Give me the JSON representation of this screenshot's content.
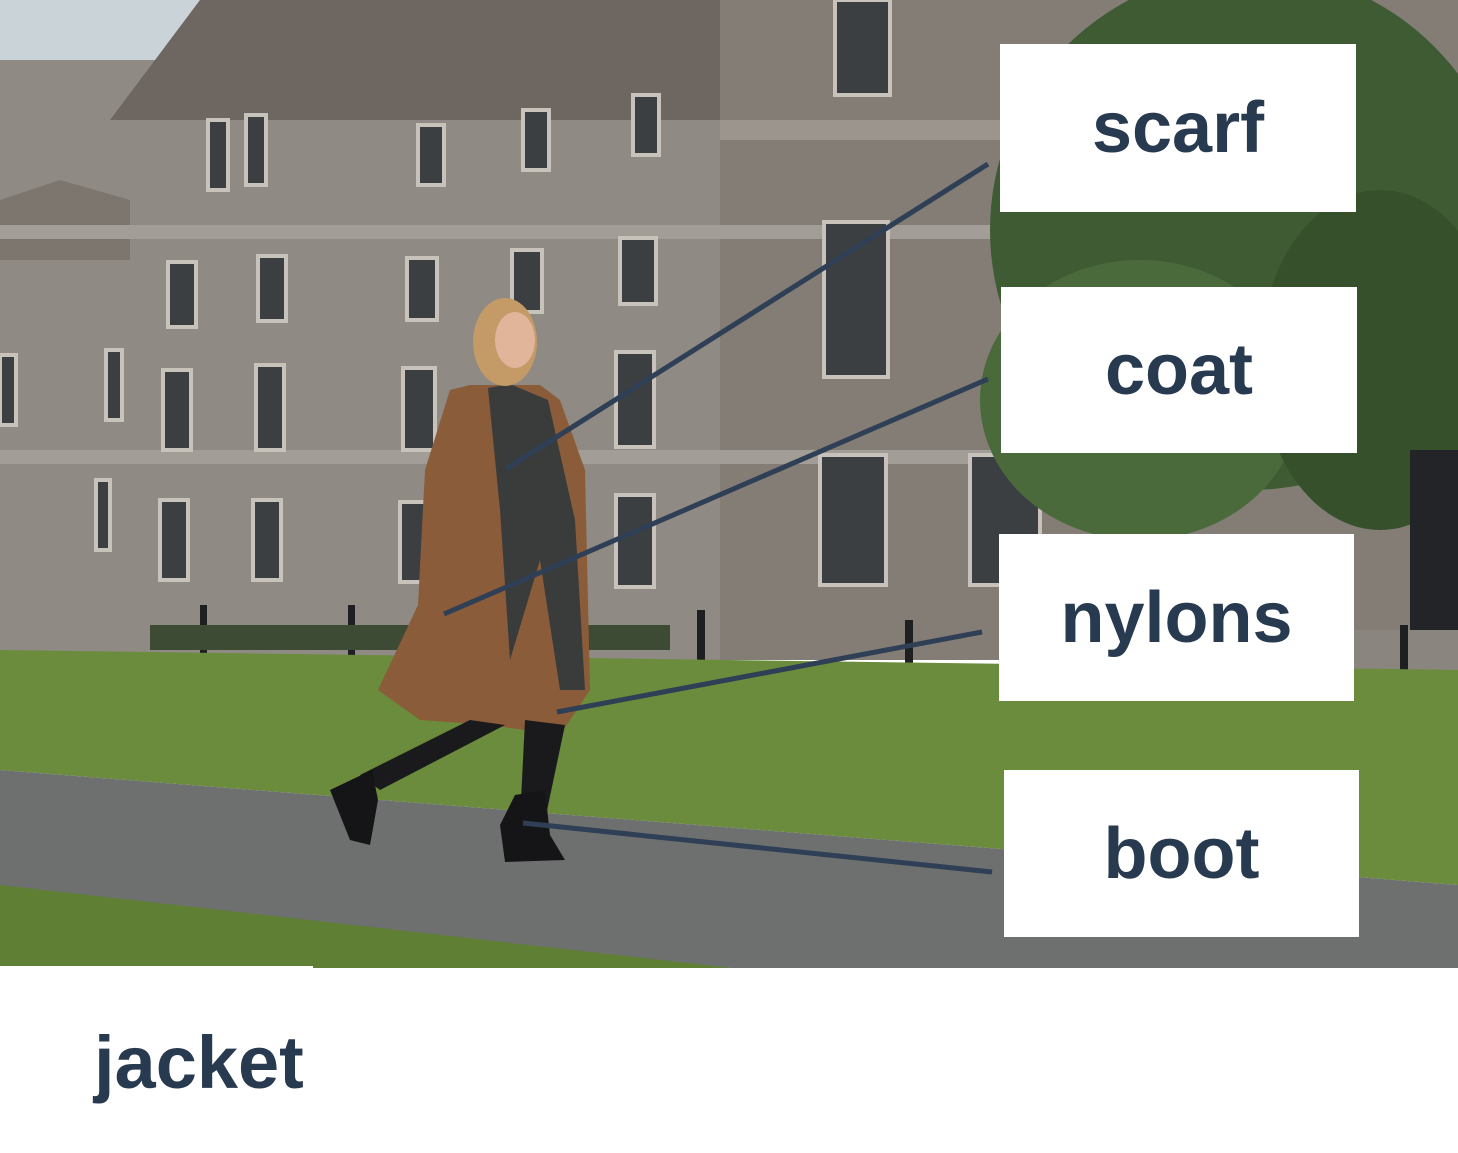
{
  "labels": {
    "scarf": "scarf",
    "coat": "coat",
    "nylons": "nylons",
    "boot": "boot"
  },
  "answer": "jacket",
  "colors": {
    "label_text": "#283a4f",
    "leader_line": "#2f3f55",
    "label_background": "#ffffff"
  }
}
